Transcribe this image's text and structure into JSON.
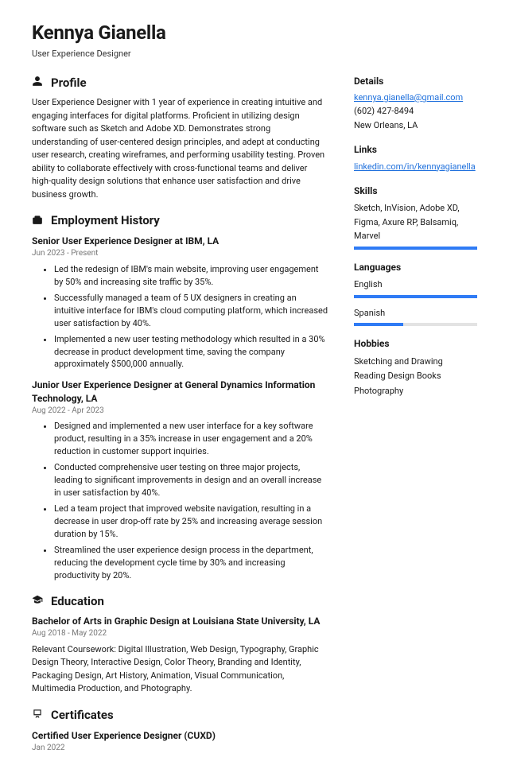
{
  "header": {
    "name": "Kennya Gianella",
    "title": "User Experience Designer"
  },
  "profile": {
    "heading": "Profile",
    "text": "User Experience Designer with 1 year of experience in creating intuitive and engaging interfaces for digital platforms. Proficient in utilizing design software such as Sketch and Adobe XD. Demonstrates strong understanding of user-centered design principles, and adept at conducting user research, creating wireframes, and performing usability testing. Proven ability to collaborate effectively with cross-functional teams and deliver high-quality design solutions that enhance user satisfaction and drive business growth."
  },
  "employment": {
    "heading": "Employment History",
    "jobs": [
      {
        "title": "Senior User Experience Designer at IBM, LA",
        "dates": "Jun 2023 - Present",
        "bullets": [
          "Led the redesign of IBM's main website, improving user engagement by 50% and increasing site traffic by 35%.",
          "Successfully managed a team of 5 UX designers in creating an intuitive interface for IBM's cloud computing platform, which increased user satisfaction by 40%.",
          "Implemented a new user testing methodology which resulted in a 30% decrease in product development time, saving the company approximately $500,000 annually."
        ]
      },
      {
        "title": "Junior User Experience Designer at General Dynamics Information Technology, LA",
        "dates": "Aug 2022 - Apr 2023",
        "bullets": [
          "Designed and implemented a new user interface for a key software product, resulting in a 35% increase in user engagement and a 20% reduction in customer support inquiries.",
          "Conducted comprehensive user testing on three major projects, leading to significant improvements in design and an overall increase in user satisfaction by 40%.",
          "Led a team project that improved website navigation, resulting in a decrease in user drop-off rate by 25% and increasing average session duration by 15%.",
          "Streamlined the user experience design process in the department, reducing the development cycle time by 30% and increasing productivity by 20%."
        ]
      }
    ]
  },
  "education": {
    "heading": "Education",
    "degree": "Bachelor of Arts in Graphic Design at Louisiana State University, LA",
    "dates": "Aug 2018 - May 2022",
    "desc": "Relevant Coursework: Digital Illustration, Web Design, Typography, Graphic Design Theory, Interactive Design, Color Theory, Branding and Identity, Packaging Design, Art History, Animation, Visual Communication, Multimedia Production, and Photography."
  },
  "certificates": {
    "heading": "Certificates",
    "name": "Certified User Experience Designer (CUXD)",
    "dates": "Jan 2022"
  },
  "details": {
    "heading": "Details",
    "email": "kennya.gianella@gmail.com",
    "phone": "(602) 427-8494",
    "location": "New Orleans, LA"
  },
  "links": {
    "heading": "Links",
    "url": "linkedin.com/in/kennyagianella"
  },
  "skills": {
    "heading": "Skills",
    "text": "Sketch, InVision, Adobe XD, Figma, Axure RP, Balsamiq, Marvel",
    "level": 100
  },
  "languages": {
    "heading": "Languages",
    "items": [
      {
        "name": "English",
        "level": 100
      },
      {
        "name": "Spanish",
        "level": 40
      }
    ]
  },
  "hobbies": {
    "heading": "Hobbies",
    "items": [
      "Sketching and Drawing",
      "Reading Design Books",
      "Photography"
    ]
  }
}
